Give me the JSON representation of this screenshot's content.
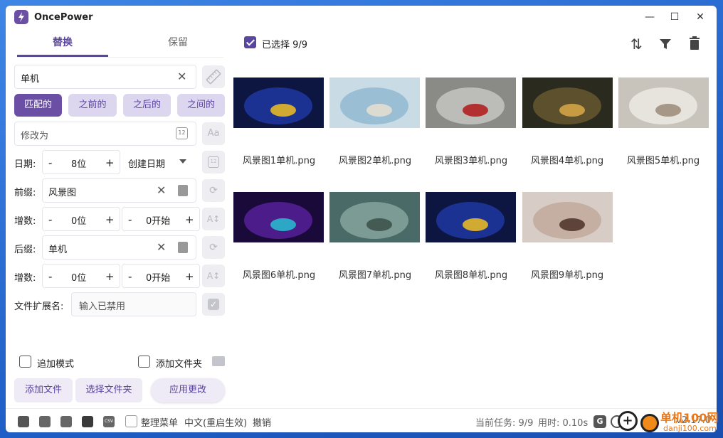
{
  "app": {
    "title": "OncePower",
    "window_controls": {
      "minimize": "—",
      "maximize": "☐",
      "close": "✕"
    }
  },
  "tabs": {
    "replace": "替换",
    "keep": "保留"
  },
  "find": {
    "value": "单机"
  },
  "modes": [
    "匹配的",
    "之前的",
    "之后的",
    "之间的"
  ],
  "modify": {
    "placeholder": "修改为"
  },
  "date": {
    "label": "日期:",
    "value": "8位",
    "type": "创建日期"
  },
  "prefix": {
    "label": "前缀:",
    "value": "风景图"
  },
  "inc1": {
    "label": "增数:",
    "digits": "0位",
    "start": "0开始"
  },
  "suffix": {
    "label": "后缀:",
    "value": "单机"
  },
  "inc2": {
    "label": "增数:",
    "digits": "0位",
    "start": "0开始"
  },
  "ext": {
    "label": "文件扩展名:",
    "placeholder": "输入已禁用"
  },
  "options": {
    "append_mode": "追加模式",
    "add_folder": "添加文件夹"
  },
  "buttons": {
    "add_file": "添加文件",
    "select_folder": "选择文件夹",
    "apply": "应用更改"
  },
  "selection": {
    "label": "已选择 9/9"
  },
  "stepper": {
    "minus": "-",
    "plus": "+"
  },
  "files": [
    {
      "name": "风景图1单机.png",
      "colors": [
        "#0d1640",
        "#1f3aa8",
        "#f0c020"
      ]
    },
    {
      "name": "风景图2单机.png",
      "colors": [
        "#c9dce6",
        "#8fb7cf",
        "#e8e0d0"
      ]
    },
    {
      "name": "风景图3单机.png",
      "colors": [
        "#8a8a86",
        "#c8c8c4",
        "#b01818"
      ]
    },
    {
      "name": "风景图4单机.png",
      "colors": [
        "#2a2a1e",
        "#6a5a30",
        "#d8a848"
      ]
    },
    {
      "name": "风景图5单机.png",
      "colors": [
        "#c8c4bc",
        "#efece6",
        "#9a8a78"
      ]
    },
    {
      "name": "风景图6单机.png",
      "colors": [
        "#1a0a3a",
        "#5a20a0",
        "#28c0d0"
      ]
    },
    {
      "name": "风景图7单机.png",
      "colors": [
        "#4a6a68",
        "#8aa8a0",
        "#3a5048"
      ]
    },
    {
      "name": "风景图8单机.png",
      "colors": [
        "#0d1640",
        "#1f3aa8",
        "#f0c020"
      ]
    },
    {
      "name": "风景图9单机.png",
      "colors": [
        "#d8ccc6",
        "#c0a898",
        "#4a3028"
      ]
    }
  ],
  "statusbar": {
    "menu": "整理菜单",
    "lang": "中文(重启生效)",
    "undo": "撤销",
    "task": "当前任务: 9/9",
    "time": "用时: 0.10s",
    "version": "v2.17.0"
  },
  "watermark": {
    "site": "单机100网",
    "url": "danji100.com"
  },
  "accent": "#5a45a0"
}
